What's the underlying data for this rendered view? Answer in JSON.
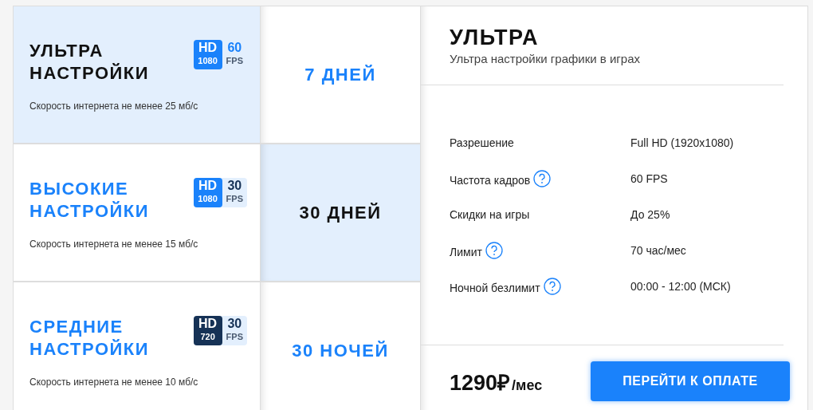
{
  "plans": [
    {
      "title": "УЛЬТРА НАСТРОЙКИ",
      "selected": true,
      "badge": {
        "hd": "HD",
        "resolution": "1080",
        "color": "#1a82fb",
        "fps": "60",
        "fps_unit": "FPS"
      },
      "speed": "Скорость интернета не менее 25 мб/с"
    },
    {
      "title": "ВЫСОКИЕ НАСТРОЙКИ",
      "selected": false,
      "badge": {
        "hd": "HD",
        "resolution": "1080",
        "color": "#1a82fb",
        "fps": "30",
        "fps_unit": "FPS"
      },
      "speed": "Скорость интернета не менее 15 мб/с"
    },
    {
      "title": "СРЕДНИЕ НАСТРОЙКИ",
      "selected": false,
      "badge": {
        "hd": "HD",
        "resolution": "720",
        "color": "#163256",
        "fps": "30",
        "fps_unit": "FPS"
      },
      "speed": "Скорость интернета не менее 10 мб/с"
    }
  ],
  "periods": [
    {
      "label": "7 ДНЕЙ",
      "selected": false
    },
    {
      "label": "30 ДНЕЙ",
      "selected": true
    },
    {
      "label": "30 НОЧЕЙ",
      "selected": false
    }
  ],
  "details": {
    "title": "УЛЬТРА",
    "subtitle": "Ультра настройки графики в играх",
    "specs": [
      {
        "label": "Разрешение",
        "help": false,
        "value": "Full HD (1920x1080)"
      },
      {
        "label": "Частота кадров",
        "help": true,
        "value": "60 FPS"
      },
      {
        "label": "Скидки на игры",
        "help": false,
        "value": "До 25%"
      },
      {
        "label": "Лимит",
        "help": true,
        "value": "70 час/мес"
      },
      {
        "label": "Ночной безлимит",
        "help": true,
        "value": "00:00 - 12:00 (МСК)"
      }
    ],
    "price": "1290₽",
    "price_unit": "/мес",
    "button": "ПЕРЕЙТИ К ОПЛАТЕ"
  }
}
